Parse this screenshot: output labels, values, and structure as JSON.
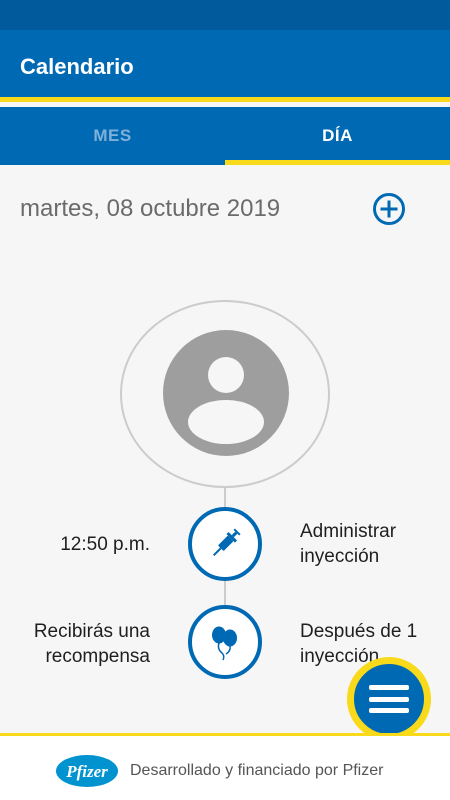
{
  "app_bar": {
    "title": "Calendario"
  },
  "tabs": [
    {
      "label": "MES",
      "active": false
    },
    {
      "label": "DÍA",
      "active": true
    }
  ],
  "day_view": {
    "date": "martes, 08 octubre 2019",
    "add_icon": "plus-circle-icon",
    "avatar_icon": "user-placeholder-icon"
  },
  "timeline": [
    {
      "left_text": "12:50 p.m.",
      "icon": "syringe-icon",
      "right_text": "Administrar inyección"
    },
    {
      "left_text": "Recibirás una recompensa",
      "icon": "balloons-icon",
      "right_text": "Después de 1 inyección"
    }
  ],
  "fab": {
    "icon": "menu-icon"
  },
  "footer": {
    "logo_text": "Pfizer",
    "text": "Desarrollado y financiado por Pfizer"
  },
  "colors": {
    "primary": "#0069b4",
    "status_bar": "#005a9c",
    "accent": "#f9da1a",
    "tab_inactive": "#7fb0d8",
    "date_text": "#6b6b6b"
  }
}
